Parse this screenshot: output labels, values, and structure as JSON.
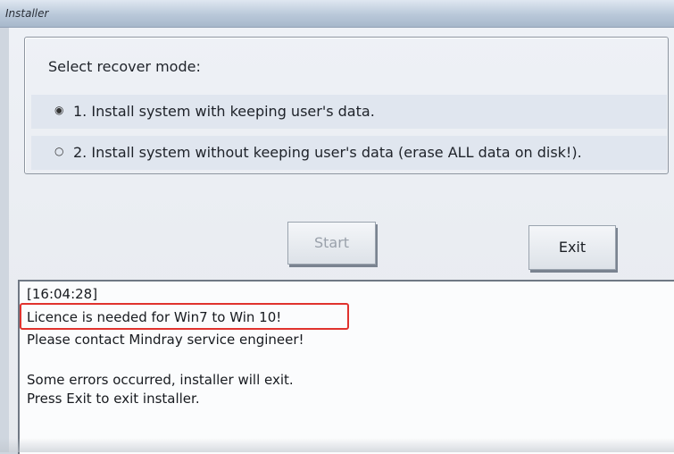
{
  "window": {
    "title": "Installer"
  },
  "recover_mode": {
    "legend": "Select recover mode:",
    "options": [
      {
        "marker": "◉",
        "label": "1. Install system with keeping user's data.",
        "selected": true
      },
      {
        "marker": "○",
        "label": "2. Install system without keeping user's data (erase ALL data on disk!).",
        "selected": false
      }
    ]
  },
  "buttons": {
    "start": "Start",
    "exit": "Exit"
  },
  "log": {
    "lines": [
      "[16:04:28]",
      "Licence is needed for Win7 to Win 10!",
      "Please contact Mindray service engineer!",
      "",
      "Some errors occurred, installer will exit.",
      "Press Exit to exit installer."
    ]
  },
  "colors": {
    "highlight": "#e0322d"
  }
}
